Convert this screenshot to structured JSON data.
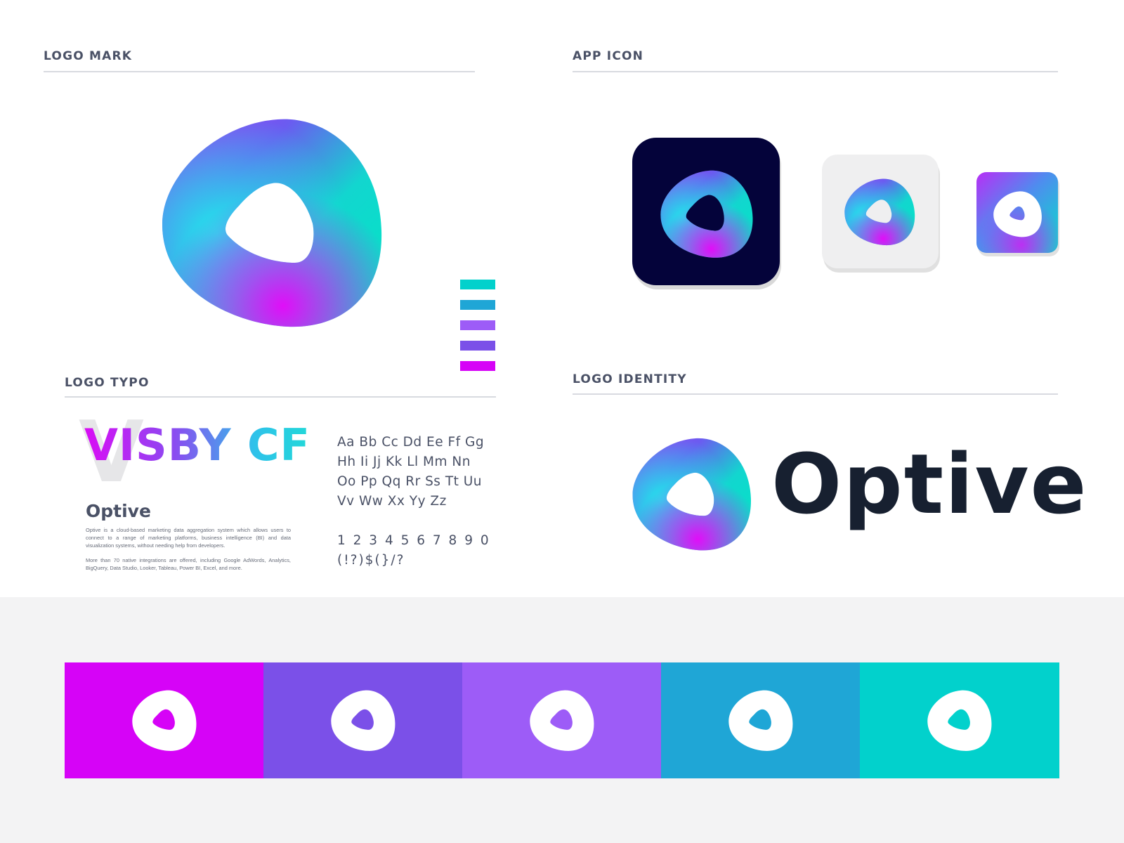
{
  "sections": {
    "logo_mark": "LOGO MARK",
    "app_icon": "APP ICON",
    "logo_typo": "LOGO TYPO",
    "logo_identity": "LOGO IDENTITY"
  },
  "typography": {
    "font_name": "VISBY CF",
    "ghost_letter": "V",
    "brand_name": "Optive",
    "paragraph_1": "Optive is a cloud-based marketing data aggregation system which allows users to connect to a range of marketing platforms, business intelligence (BI) and data visualization systems, without needing help from developers.",
    "paragraph_2": "More than 70 native integrations are offered, including Google AdWords, Analytics, BigQuery, Data Studio, Looker, Tableau, Power BI, Excel, and more.",
    "alphabet_lines": [
      "Aa Bb Cc Dd Ee Ff Gg",
      "Hh Ii Jj Kk Ll Mm Nn",
      "Oo Pp Qq Rr Ss Tt Uu",
      "Vv Ww Xx Yy Zz"
    ],
    "numerals": "1 2 3 4 5 6 7 8 9 0",
    "symbols": "(!?)$(}/?"
  },
  "identity": {
    "wordmark": "Optive"
  },
  "palette": [
    "#d603f7",
    "#7b50e8",
    "#9d5cf7",
    "#1fa6d6",
    "#02d1cc"
  ],
  "icons": {
    "logo_mark": "optive-ring-logo",
    "app_icons": [
      "app-icon-dark",
      "app-icon-light",
      "app-icon-gradient"
    ]
  },
  "colors": {
    "dark_bg": "#04033a",
    "text_dark": "#172030",
    "heading": "#4a5166"
  }
}
